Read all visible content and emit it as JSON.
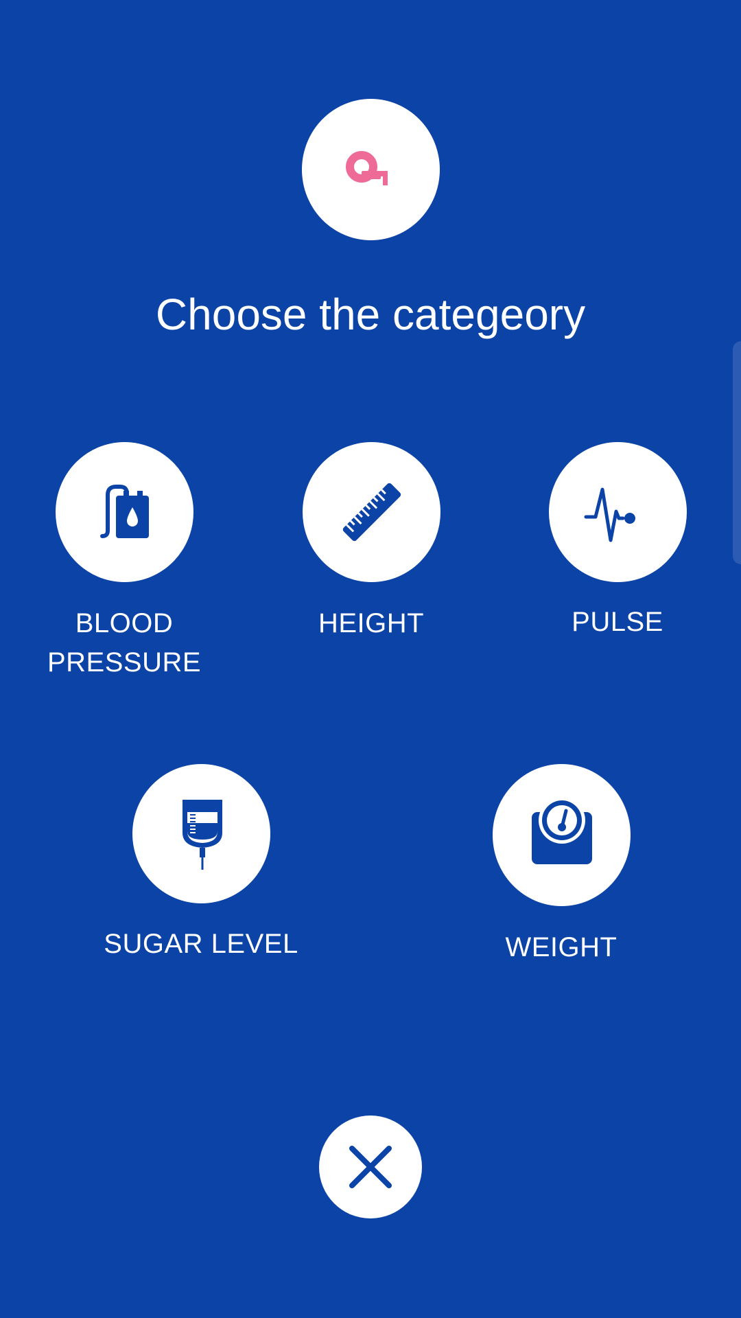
{
  "title": "Choose the categeory",
  "colors": {
    "background": "#0C43A7",
    "circle": "#FFFFFF",
    "icon": "#0C43A7",
    "accent_icon": "#EE6A97"
  },
  "header_icon": "tape-measure-icon",
  "categories": [
    {
      "label": "BLOOD PRESSURE",
      "icon": "blood-pressure-icon"
    },
    {
      "label": "HEIGHT",
      "icon": "ruler-icon"
    },
    {
      "label": "PULSE",
      "icon": "pulse-icon"
    },
    {
      "label": "SUGAR LEVEL",
      "icon": "iv-bag-icon"
    },
    {
      "label": "WEIGHT",
      "icon": "scale-icon"
    }
  ],
  "close_icon": "close-icon"
}
